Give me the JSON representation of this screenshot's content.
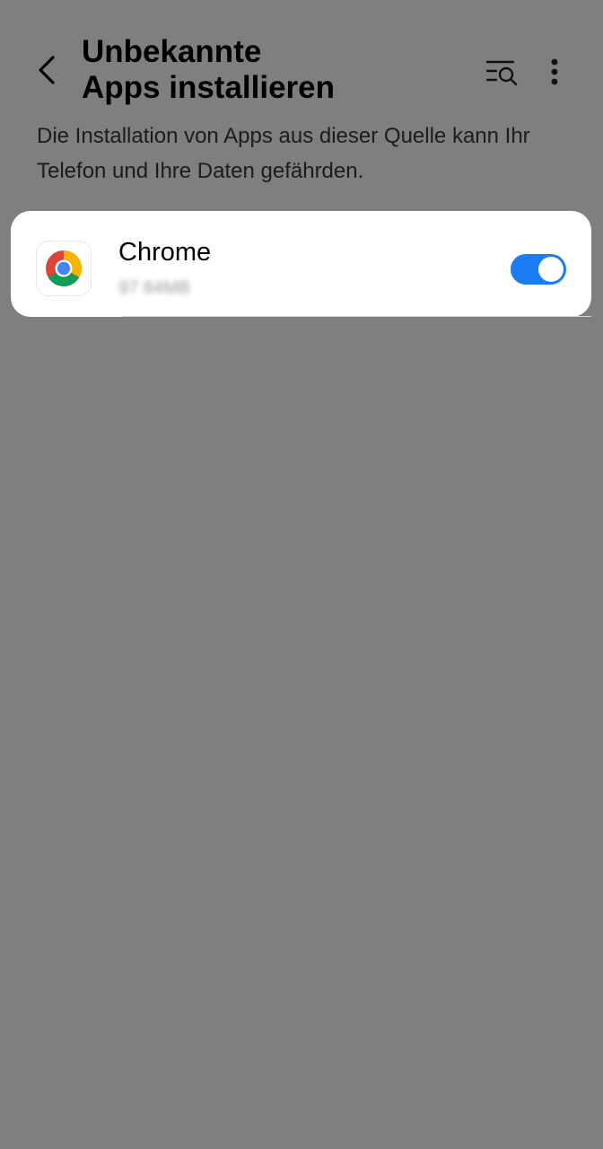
{
  "header": {
    "title_line1": "Unbekannte",
    "title_line2": "Apps installieren",
    "back_icon": "chevron-left-icon",
    "search_icon": "list-search-icon",
    "more_icon": "more-vertical-icon"
  },
  "description": "Die Installation von Apps aus dieser Quelle kann Ihr Telefon und Ihre Daten gefährden.",
  "apps": [
    {
      "name": "Chrome",
      "size": "97 84MB",
      "icon": "chrome-icon",
      "allowed": true
    }
  ],
  "colors": {
    "background": "#7f7f7f",
    "card": "#ffffff",
    "toggle_on": "#1a7cf2"
  }
}
